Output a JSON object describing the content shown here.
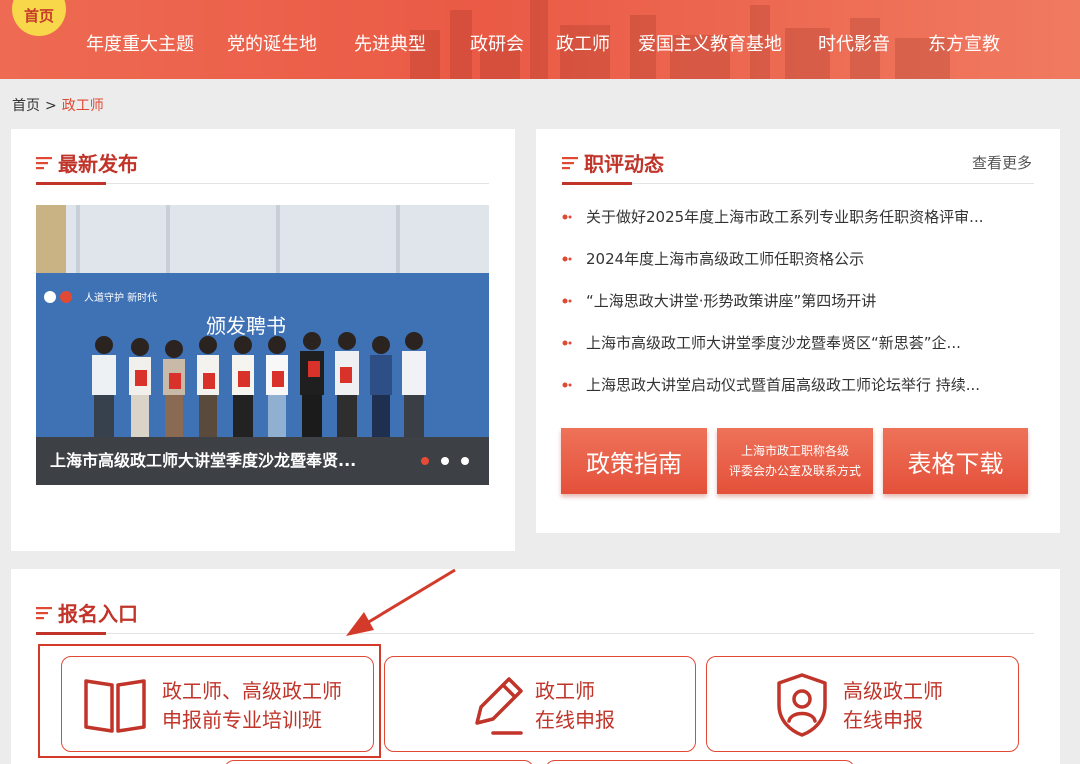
{
  "nav": {
    "home_badge": "首页",
    "items": [
      "年度重大主题",
      "党的诞生地",
      "先进典型",
      "政研会",
      "政工师",
      "爱国主义教育基地",
      "时代影音",
      "东方宣教"
    ]
  },
  "breadcrumb": {
    "home": "首页",
    "separator": ">",
    "current": "政工师"
  },
  "latest": {
    "title": "最新发布",
    "caption": "上海市高级政工师大讲堂季度沙龙暨奉贤...",
    "banner_line1": "人道守护 新时代",
    "banner_line2": "颁发聘书"
  },
  "zhiping": {
    "title": "职评动态",
    "more": "查看更多",
    "items": [
      "关于做好2025年度上海市政工系列专业职务任职资格评审...",
      "2024年度上海市高级政工师任职资格公示",
      "“上海思政大讲堂·形势政策讲座”第四场开讲",
      "上海市高级政工师大讲堂季度沙龙暨奉贤区“新思荟”企...",
      "上海思政大讲堂启动仪式暨首届高级政工师论坛举行 持续..."
    ]
  },
  "actions": {
    "policy": "政策指南",
    "office_line1": "上海市政工职称各级",
    "office_line2": "评委会办公室及联系方式",
    "forms": "表格下载"
  },
  "registration": {
    "title": "报名入口",
    "training_line1": "政工师、高级政工师",
    "training_line2": "申报前专业培训班",
    "zgs_line1": "政工师",
    "zgs_line2": "在线申报",
    "senior_line1": "高级政工师",
    "senior_line2": "在线申报"
  },
  "colors": {
    "brand_red": "#e04a35",
    "dark_red": "#c0342a",
    "yellow": "#f8d84a"
  }
}
